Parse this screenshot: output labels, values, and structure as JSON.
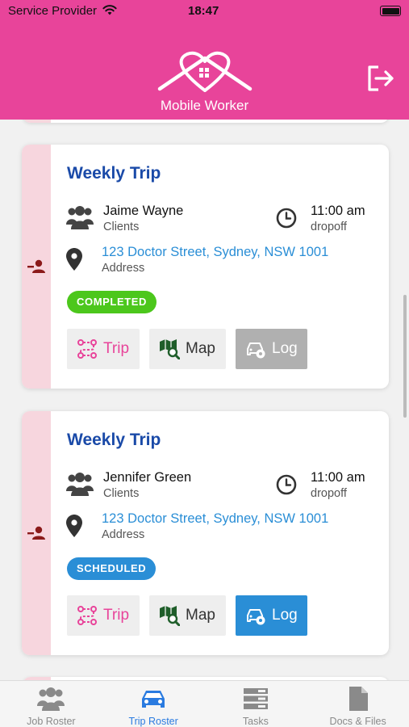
{
  "status_bar": {
    "carrier": "Service Provider",
    "time": "18:47"
  },
  "header": {
    "app_name": "Mobile Worker",
    "logout_icon": "logout-icon",
    "logo_icon": "house-heart-logo"
  },
  "colors": {
    "brand": "#e8449a",
    "title": "#1a4aa8",
    "link": "#2a8ed6",
    "completed": "#4cc71c",
    "scheduled": "#2a8ed6",
    "log_active": "#2a8ed6",
    "log_disabled": "#b0b0b0"
  },
  "trips": [
    {
      "title": "Weekly Trip",
      "client_name": "Jaime Wayne",
      "client_label": "Clients",
      "time": "11:00 am",
      "time_label": "dropoff",
      "address": "123 Doctor Street, Sydney, NSW 1001",
      "address_label": "Address",
      "status": "COMPLETED",
      "buttons": {
        "trip": "Trip",
        "map": "Map",
        "log": "Log"
      },
      "log_enabled": false
    },
    {
      "title": "Weekly Trip",
      "client_name": "Jennifer Green",
      "client_label": "Clients",
      "time": "11:00 am",
      "time_label": "dropoff",
      "address": "123 Doctor Street, Sydney, NSW 1001",
      "address_label": "Address",
      "status": "SCHEDULED",
      "buttons": {
        "trip": "Trip",
        "map": "Map",
        "log": "Log"
      },
      "log_enabled": true
    }
  ],
  "tabs": [
    {
      "label": "Job Roster",
      "icon": "people-icon",
      "active": false
    },
    {
      "label": "Trip Roster",
      "icon": "car-icon",
      "active": true
    },
    {
      "label": "Tasks",
      "icon": "tasks-icon",
      "active": false
    },
    {
      "label": "Docs & Files",
      "icon": "document-icon",
      "active": false
    }
  ]
}
